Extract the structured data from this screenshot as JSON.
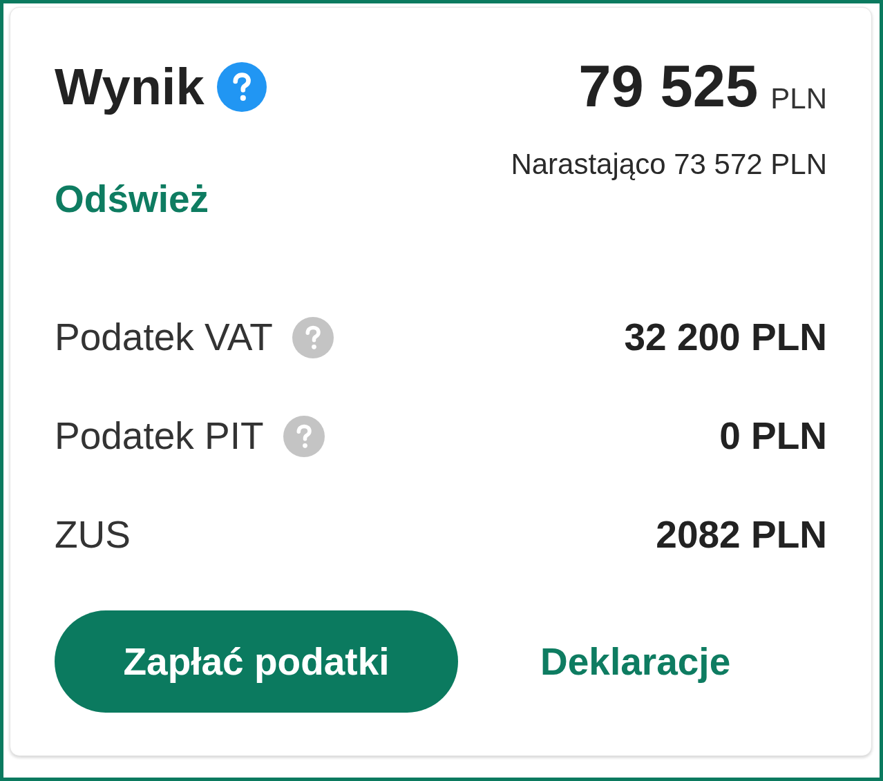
{
  "summary": {
    "title": "Wynik",
    "help": true,
    "amount": "79 525",
    "currency": "PLN",
    "cumulative": "Narastająco 73 572 PLN",
    "refresh_link": "Odśwież"
  },
  "taxes": [
    {
      "label": "Podatek VAT",
      "help": true,
      "value": "32 200 PLN"
    },
    {
      "label": "Podatek PIT",
      "help": true,
      "value": "0 PLN"
    },
    {
      "label": "ZUS",
      "help": false,
      "value": "2082 PLN"
    }
  ],
  "actions": {
    "primary_button": "Zapłać podatki",
    "link": "Deklaracje"
  }
}
